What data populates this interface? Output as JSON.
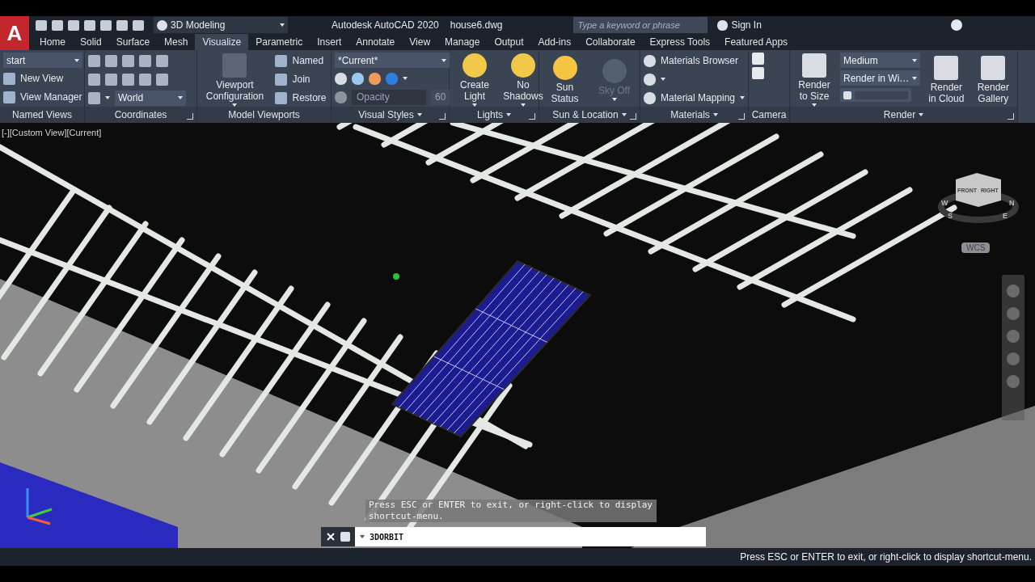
{
  "app_menu": {
    "letter": "A"
  },
  "quick_access": {
    "workspace": "3D Modeling"
  },
  "title_bar": {
    "app": "Autodesk AutoCAD 2020",
    "file": "house6.dwg",
    "search_placeholder": "Type a keyword or phrase",
    "sign_in": "Sign In"
  },
  "tabs": [
    {
      "label": "Home",
      "selected": false
    },
    {
      "label": "Solid",
      "selected": false
    },
    {
      "label": "Surface",
      "selected": false
    },
    {
      "label": "Mesh",
      "selected": false
    },
    {
      "label": "Visualize",
      "selected": true
    },
    {
      "label": "Parametric",
      "selected": false
    },
    {
      "label": "Insert",
      "selected": false
    },
    {
      "label": "Annotate",
      "selected": false
    },
    {
      "label": "View",
      "selected": false
    },
    {
      "label": "Manage",
      "selected": false
    },
    {
      "label": "Output",
      "selected": false
    },
    {
      "label": "Add-ins",
      "selected": false
    },
    {
      "label": "Collaborate",
      "selected": false
    },
    {
      "label": "Express Tools",
      "selected": false
    },
    {
      "label": "Featured Apps",
      "selected": false
    }
  ],
  "ribbon_panels": [
    {
      "title": "Named Views",
      "menu": false,
      "launcher": false,
      "columns": [
        [
          {
            "kind": "combo",
            "value": "start"
          },
          {
            "kind": "small",
            "label": "New View",
            "menu": false
          },
          {
            "kind": "small",
            "label": "View Manager",
            "menu": false
          }
        ]
      ]
    },
    {
      "title": "Coordinates",
      "menu": false,
      "launcher": true,
      "columns": [
        [
          {
            "kind": "tool_grid"
          },
          {
            "kind": "icon_combo",
            "value": "World"
          }
        ]
      ]
    },
    {
      "title": "Model Viewports",
      "menu": false,
      "launcher": false,
      "columns": [
        [
          {
            "kind": "large",
            "label": "Viewport Configuration",
            "menu": true,
            "disabled": false
          }
        ],
        [
          {
            "kind": "small",
            "label": "Named",
            "menu": false
          },
          {
            "kind": "small",
            "label": "Join",
            "menu": false
          },
          {
            "kind": "small",
            "label": "Restore",
            "menu": false
          }
        ]
      ]
    },
    {
      "title": "Visual Styles",
      "menu": true,
      "launcher": true,
      "columns": [
        [
          {
            "kind": "combo",
            "value": "*Current*"
          },
          {
            "kind": "tool_row"
          },
          {
            "kind": "field",
            "placeholder": "Opacity",
            "value": "60",
            "disabled": true
          }
        ]
      ]
    },
    {
      "title": "Lights",
      "menu": true,
      "launcher": true,
      "columns": [
        [
          {
            "kind": "large",
            "label": "Create Light",
            "menu": true,
            "disabled": false
          }
        ],
        [
          {
            "kind": "large",
            "label": "No Shadows",
            "menu": true,
            "disabled": false
          }
        ]
      ]
    },
    {
      "title": "Sun & Location",
      "menu": true,
      "launcher": true,
      "columns": [
        [
          {
            "kind": "large",
            "label": "Sun Status",
            "menu": false,
            "disabled": false
          }
        ],
        [
          {
            "kind": "large",
            "label": "Sky Off",
            "menu": true,
            "disabled": true
          }
        ]
      ]
    },
    {
      "title": "Materials",
      "menu": true,
      "launcher": true,
      "columns": [
        [
          {
            "kind": "small",
            "label": "Materials Browser",
            "menu": false
          },
          {
            "kind": "tool_row"
          },
          {
            "kind": "small",
            "label": "Material Mapping",
            "menu": true
          }
        ]
      ]
    },
    {
      "title": "Camera",
      "menu": false,
      "launcher": false,
      "columns": [
        [
          {
            "kind": "icon_stack"
          }
        ]
      ]
    },
    {
      "title": "Render",
      "menu": true,
      "launcher": true,
      "columns": [
        [
          {
            "kind": "large",
            "label": "Render to Size",
            "menu": true,
            "disabled": false
          }
        ],
        [
          {
            "kind": "combo",
            "value": "Medium"
          },
          {
            "kind": "combo",
            "value": "Render in Wi…"
          },
          {
            "kind": "progress",
            "level": 0
          }
        ],
        [
          {
            "kind": "large",
            "label": "Render in Cloud",
            "menu": false,
            "disabled": false
          }
        ],
        [
          {
            "kind": "large",
            "label": "Render Gallery",
            "menu": false,
            "disabled": false
          }
        ]
      ]
    }
  ],
  "viewport": {
    "label": "[-][Custom View][Current]",
    "viewcube_faces": [
      "FRONT",
      "RIGHT"
    ],
    "compass": [
      "W",
      "N",
      "S",
      "E"
    ],
    "ucs": "WCS"
  },
  "tooltip": "Press ESC or ENTER to exit, or right-click to display shortcut-menu.",
  "command_line": {
    "value": "3DORBIT"
  },
  "status_bar": {
    "message": "Press ESC or ENTER to exit, or right-click to display shortcut-menu."
  }
}
